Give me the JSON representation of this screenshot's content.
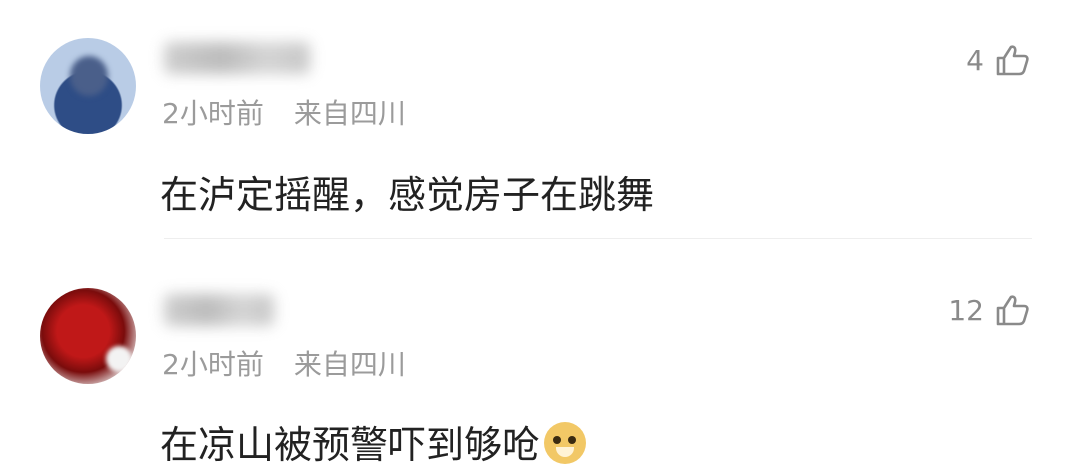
{
  "comments": [
    {
      "time": "2小时前",
      "from": "来自四川",
      "text": "在泸定摇醒，感觉房子在跳舞",
      "likes": "4",
      "like_icon": "thumbs-up-icon"
    },
    {
      "time": "2小时前",
      "from": "来自四川",
      "text": "在凉山被预警吓到够呛",
      "emoji": "doge-emoji-icon",
      "likes": "12",
      "like_icon": "thumbs-up-icon"
    }
  ]
}
